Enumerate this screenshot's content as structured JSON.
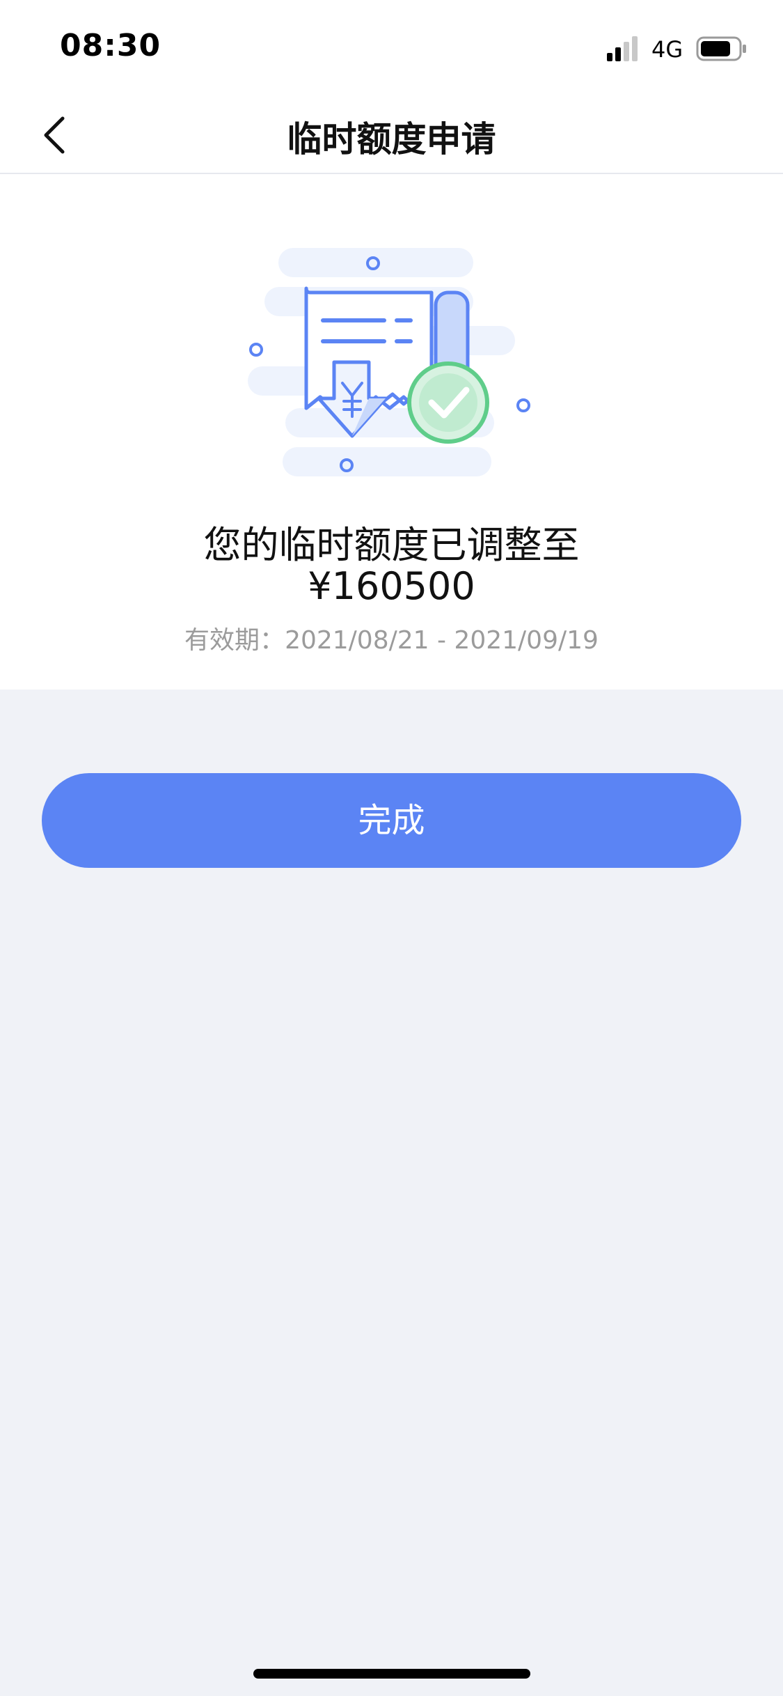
{
  "status_bar": {
    "time": "08:30",
    "network": "4G",
    "icons": [
      "signal-icon",
      "battery-icon"
    ]
  },
  "nav": {
    "title": "临时额度申请",
    "back_icon": "chevron-left-icon"
  },
  "result": {
    "message": "您的临时额度已调整至",
    "amount": "¥160500",
    "validity_label": "有效期：",
    "validity_range": "2021/08/21 - 2021/09/19",
    "illustration_icon": "receipt-success-icon"
  },
  "actions": {
    "done_label": "完成"
  },
  "colors": {
    "accent": "#5b84f4",
    "success": "#5fcd8a",
    "background": "#f0f2f7"
  }
}
